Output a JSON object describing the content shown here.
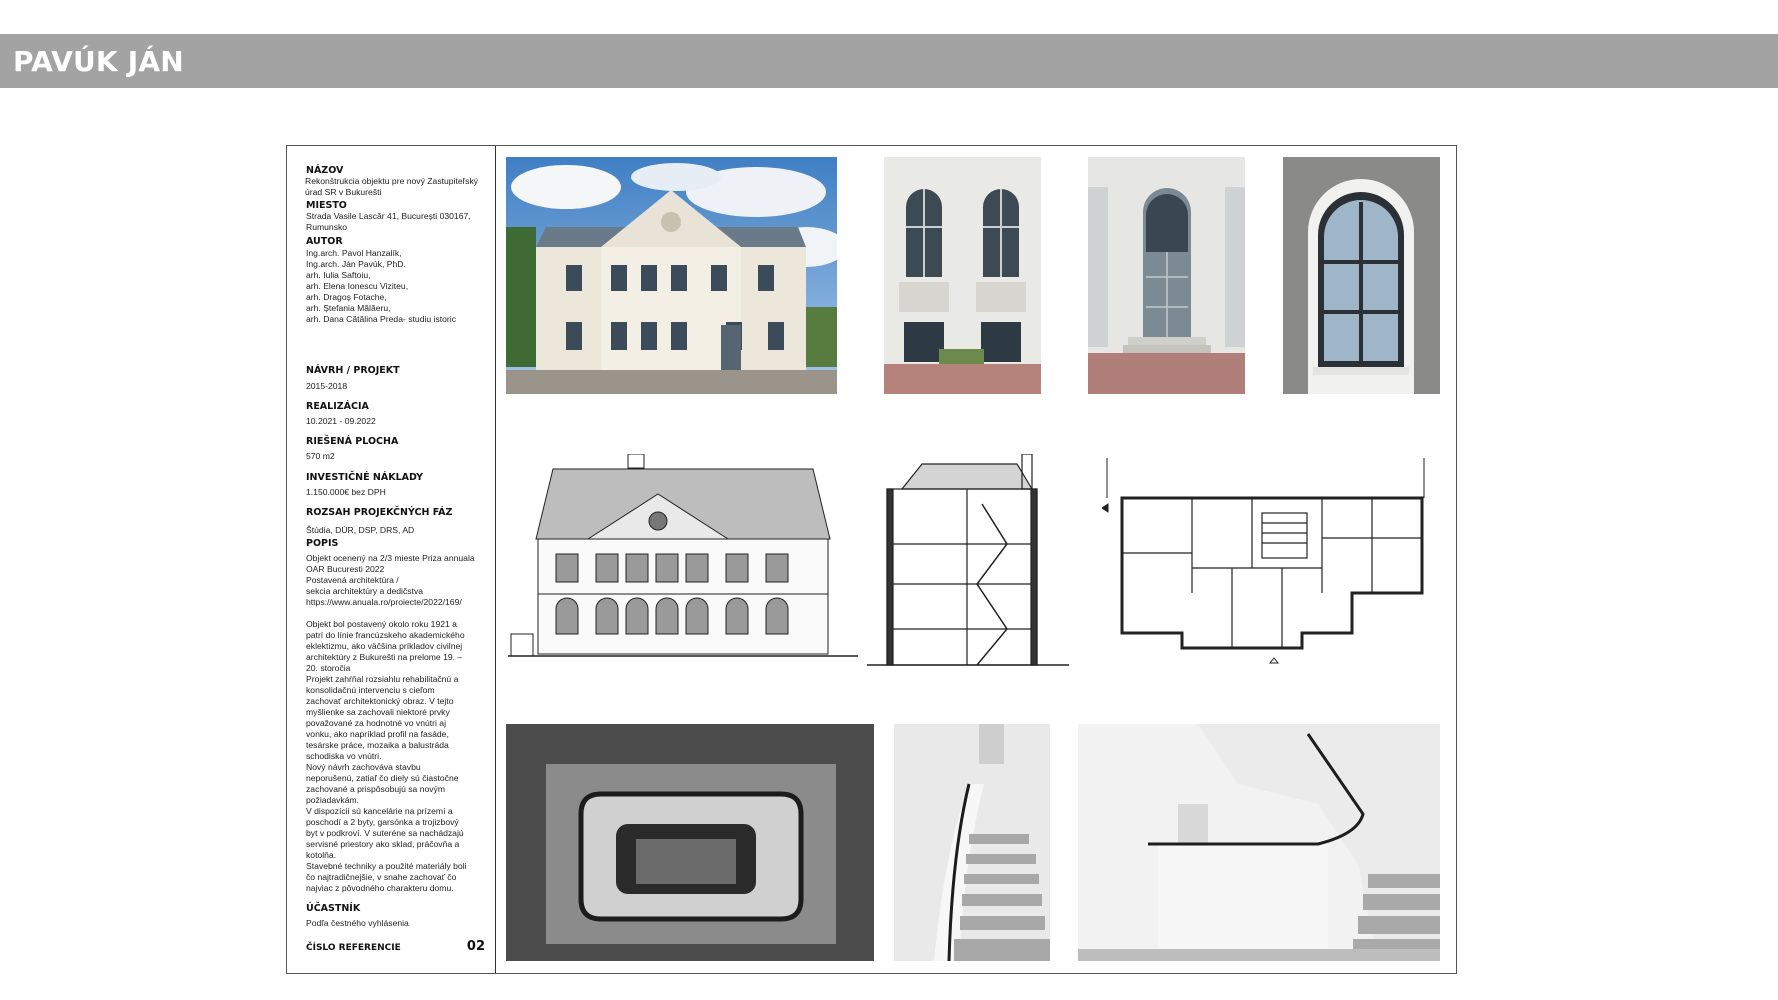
{
  "header": {
    "title": "PAVÚK JÁN",
    "bar_color": "#a3a3a3"
  },
  "info": {
    "name_label": "NÁZOV",
    "name_value": "Rekonštrukcia objektu pre nový Zastupiteľský\n úrad SR v Bukurešti",
    "place_label": "MIESTO",
    "place_value": "Strada Vasile Lascăr 41, București 030167,\nRumunsko",
    "author_label": "AUTOR",
    "author_value": "Ing.arch. Pavol Hanzalík,\nIng.arch. Ján Pavúk, PhD.\narh.    Iulia Saftoiu,\narh. Elena Ionescu Viziteu,\narh. Dragoș Fotache,\narh. Ștefania Mălăeru,\narh. Dana Cătălina Preda- studiu istoric",
    "design_label": "NÁVRH / PROJEKT",
    "design_value": "2015-2018",
    "realization_label": "REALIZÁCIA",
    "realization_value": "10.2021 - 09.2022",
    "area_label": "RIEŠENÁ PLOCHA",
    "area_value": "570 m2",
    "cost_label": "INVESTIČNÉ NÁKLADY",
    "cost_value": "1.150.000€ bez DPH",
    "phases_label": "ROZSAH PROJEKČNÝCH FÁZ",
    "phases_value": "Štúdia, DÚR, DSP, DRS, AD",
    "description_label": "POPIS",
    "description_award": "Objekt ocenený na 2/3 mieste Priza annuala\nOAR Bucuresti 2022\nPostavená architektúra /\n sekcia architektúry a dedičstva\nhttps://www.anuala.ro/proiecte/2022/169/",
    "description_body": "Objekt bol postavený okolo roku 1921 a\npatrí do línie francúzskeho akademického\neklektizmu, ako väčšina príkladov civilnej\narchitektúry z Bukurešti na prelome 19. –\n20. storočia\nProjekt zahŕňal rozsiahlu rehabilitačnú a\nkonsolidačnú intervenciu s cieľom\nzachovať architektonický obraz. V tejto\nmyšlienke sa zachovali niektoré prvky\npovažované za hodnotné vo vnútri aj\nvonku, ako napríklad profil na fasáde,\ntesárske práce, mozaika a balustráda\nschodiska vo vnútri.\nNový návrh zachováva stavbu\nneporušenú, zatiaľ čo diely sú čiastočne\nzachované a prispôsobujú sa novým\npožiadavkám.\nV dispozícii sú kancelárie na prízemí a\nposchodí a 2 byty, garsónka a trojizbový\nbyt v podkroví. V suteréne sa nachádzajú\nservisné priestory ako sklad, práčovňa a\nkotolňa.\nStavebné techniky a použité materiály boli\nčo najtradičnejšie, v snahe zachovať čo\nnajviac z pôvodného charakteru domu.",
    "participant_label": "ÚČASTNÍK",
    "participant_value": "Podľa čestného vyhlásenia",
    "reference_label": "ČÍSLO REFERENCIE",
    "reference_number": "02"
  }
}
